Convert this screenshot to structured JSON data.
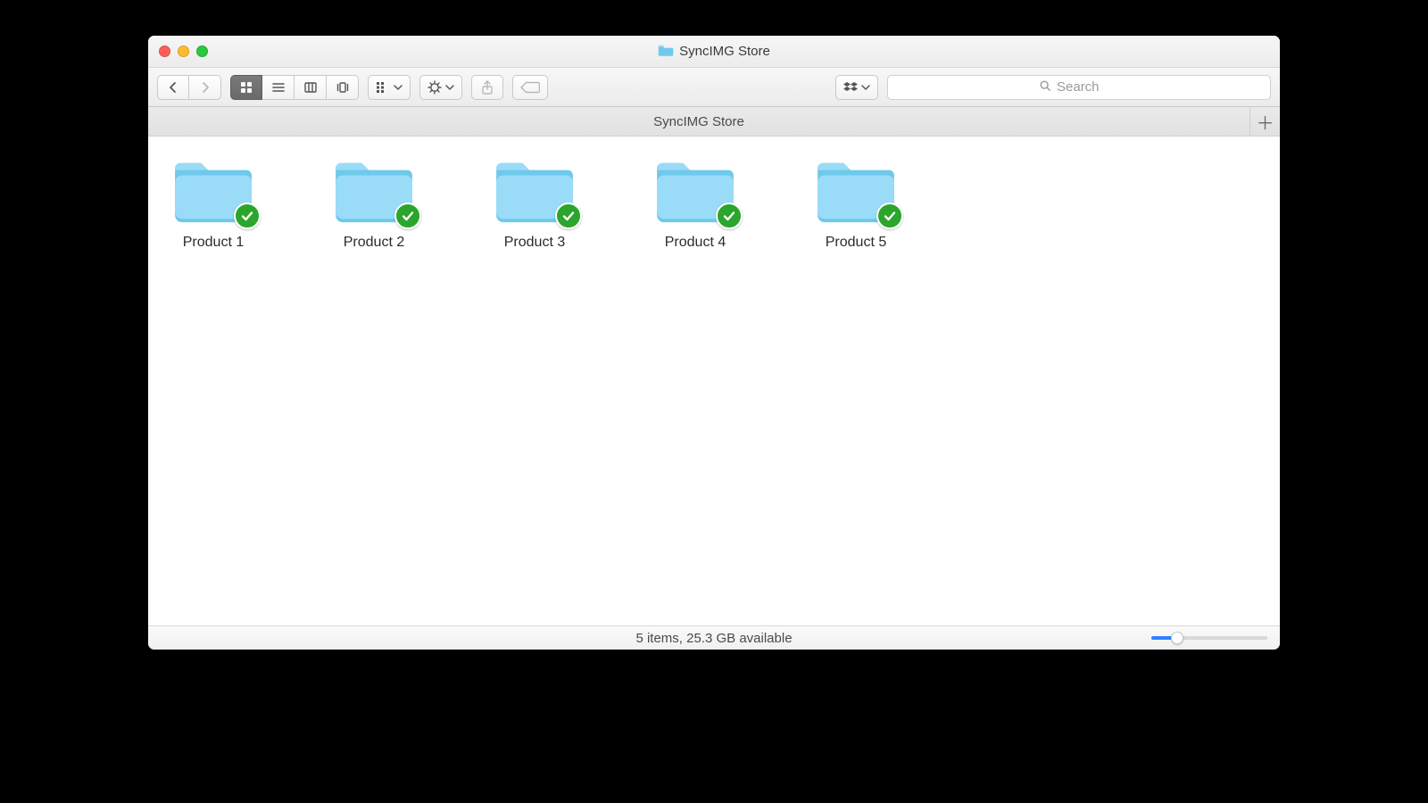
{
  "window": {
    "title": "SyncIMG Store"
  },
  "toolbar": {
    "search_placeholder": "Search"
  },
  "tabbar": {
    "current": "SyncIMG Store"
  },
  "items": [
    {
      "name": "Product 1",
      "synced": true
    },
    {
      "name": "Product 2",
      "synced": true
    },
    {
      "name": "Product 3",
      "synced": true
    },
    {
      "name": "Product 4",
      "synced": true
    },
    {
      "name": "Product 5",
      "synced": true
    }
  ],
  "status": {
    "text": "5 items, 25.3 GB available",
    "zoom_fraction": 0.22
  },
  "colors": {
    "folder_light": "#9adcf7",
    "folder_dark": "#6ec9ec",
    "badge_green": "#2ba52b"
  }
}
